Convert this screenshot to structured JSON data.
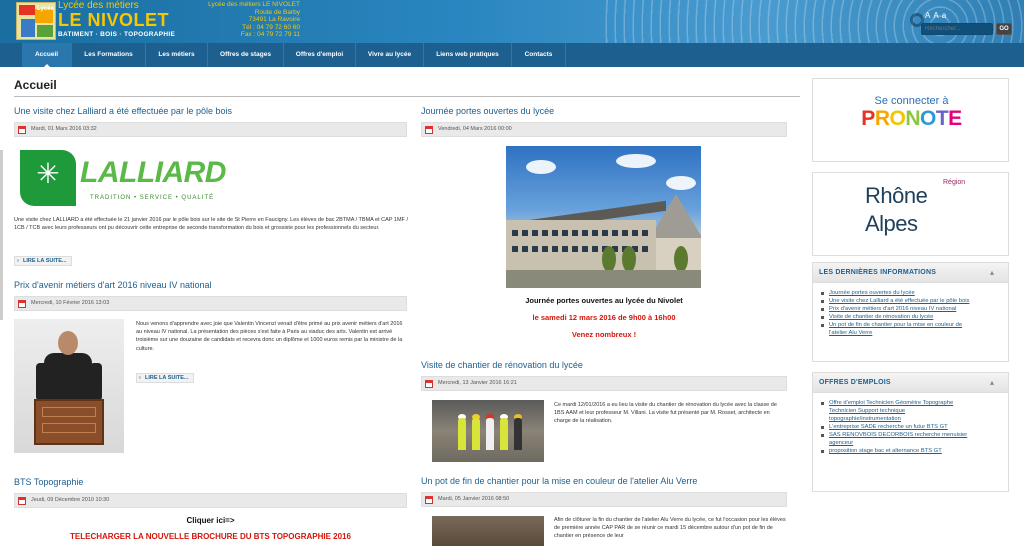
{
  "header": {
    "logo_small": "Lycée",
    "site_top": "Lycée des métiers",
    "site_name": "LE NIVOLET",
    "tagline": "BATIMENT · BOIS · TOPOGRAPHIE",
    "address": [
      "Lycée des métiers LE NIVOLET",
      "Route de Barby",
      "73491 La Ravoire",
      "Tél : 04 79 72 60 60",
      "Fax : 04 79 72 79 11"
    ],
    "font_sizer": [
      "A",
      "A",
      "a"
    ],
    "search_placeholder": "Rechercher...",
    "search_button": "GO"
  },
  "nav": {
    "items": [
      "Accueil",
      "Les Formations",
      "Les métiers",
      "Offres de stages",
      "Offres d'emploi",
      "Vivre au lycée",
      "Liens web pratiques",
      "Contacts"
    ],
    "active": "Accueil"
  },
  "page_title": "Accueil",
  "articles": {
    "lalliard": {
      "title": "Une visite chez Lalliard a été effectuée par le pôle bois",
      "date": "Mardi, 01 Mars 2016 03:32",
      "logo_word": "LALLIARD",
      "logo_slogan": "TRADITION • SERVICE • QUALITÉ",
      "text": "Une visite chez LALLIARD a été effectuée le 21 janvier 2016 par le pôle bois sur le site de St Pierre en Faucigny. Les élèves de bac 2BTMA / TBMA et CAP 1MF / 1CB / TCB avec leurs professeurs ont pu découvrir cette entreprise de seconde transformation du bois et grossiste pour les professionnels du secteur.",
      "more": "LIRE LA SUITE..."
    },
    "prix": {
      "title": "Prix d'avenir métiers d'art 2016 niveau IV national",
      "date": "Mercredi, 10 Février 2016 13:03",
      "text": "Nous venons d'apprendre avec joie que Valentin Vincenzi venait d'être primé au prix avenir métiers d'art 2016 au niveau IV national. La présentation des pièces s'est faite à Paris au viaduc des arts. Valentin est arrivé troisième sur une douzaine de candidats et recevra donc un diplôme et 1000 euros remis par la ministre de la culture.",
      "more": "LIRE LA SUITE..."
    },
    "bts": {
      "title": "BTS Topographie",
      "date": "Jeudi, 09 Décembre 2010 10:30",
      "cliquer": "Cliquer ici=>",
      "download": "TELECHARGER LA NOUVELLE BROCHURE DU BTS TOPOGRAPHIE 2016"
    },
    "jpo": {
      "title": "Journée portes ouvertes du lycée",
      "date": "Vendredi, 04 Mars 2016 00:00",
      "caption": "Journée portes ouvertes au lycée du Nivolet",
      "date_line": "le samedi 12 mars 2016 de 9h00 à 16h00",
      "welcome": "Venez nombreux !"
    },
    "chantier": {
      "title": "Visite de chantier de rénovation du lycée",
      "date": "Mercredi, 13 Janvier 2016 16:21",
      "text": "Ce mardi 12/01/2016 a eu lieu la visite du chantier de rénovation du lycée avec la classe de 1BS AAM et leur professeur M. Villani. La visite fut présenté par M. Rosset, architecte en charge de la réalisation."
    },
    "aluverre": {
      "title": "Un pot de fin de chantier pour la mise en couleur de l'atelier Alu Verre",
      "date": "Mardi, 05 Janvier 2016 08:50",
      "text": "Afin de clôturer la fin du chantier de l'atelier Alu Verre du lycée, ce fut l'occasion pour les élèves de première année CAP PAR de se réunir ce mardi 15 décembre autour d'un pot de fin de chantier en présence de leur"
    }
  },
  "sidebar": {
    "pronote_connect": "Se connecter à",
    "pronote_word": "PRONOTE",
    "pronote_colors": [
      "#e63323",
      "#f7a600",
      "#f5c400",
      "#8dc63f",
      "#2b9ad6",
      "#6c5fc7",
      "#e5007e"
    ],
    "rhone_region": "Région",
    "rhone_l1": "Rhône",
    "rhone_l2": "Alpes",
    "latest": {
      "title": "LES DERNIÈRES INFORMATIONS",
      "items": [
        "Journée portes ouvertes du lycée",
        "Une visite chez Lalliard a été effectuée par le pôle bois",
        "Prix d'avenir métiers d'art 2016 niveau IV national",
        "Visite de chantier de rénovation du lycée",
        "Un pot de fin de chantier pour la mise en couleur de",
        "l'atelier Alu Verre"
      ]
    },
    "jobs": {
      "title": "OFFRES D'EMPLOIS",
      "items": [
        "Offre d'emploi Technicien Géomètre Topographe",
        "Technicien Support technique",
        "topographie/instrumentation",
        "L'entreprise SADE recherche un futur BTS GT",
        "SAS RENOVBOIS DECORBOIS recherche menuisier",
        "agenceur",
        "proposition stage bac et alternance BTS GT"
      ]
    }
  },
  "colors": {
    "nav": "#1d5f8f",
    "link": "#1d5f8f",
    "alert_red": "#d4160b",
    "lalliard_green": "#5ab947"
  }
}
